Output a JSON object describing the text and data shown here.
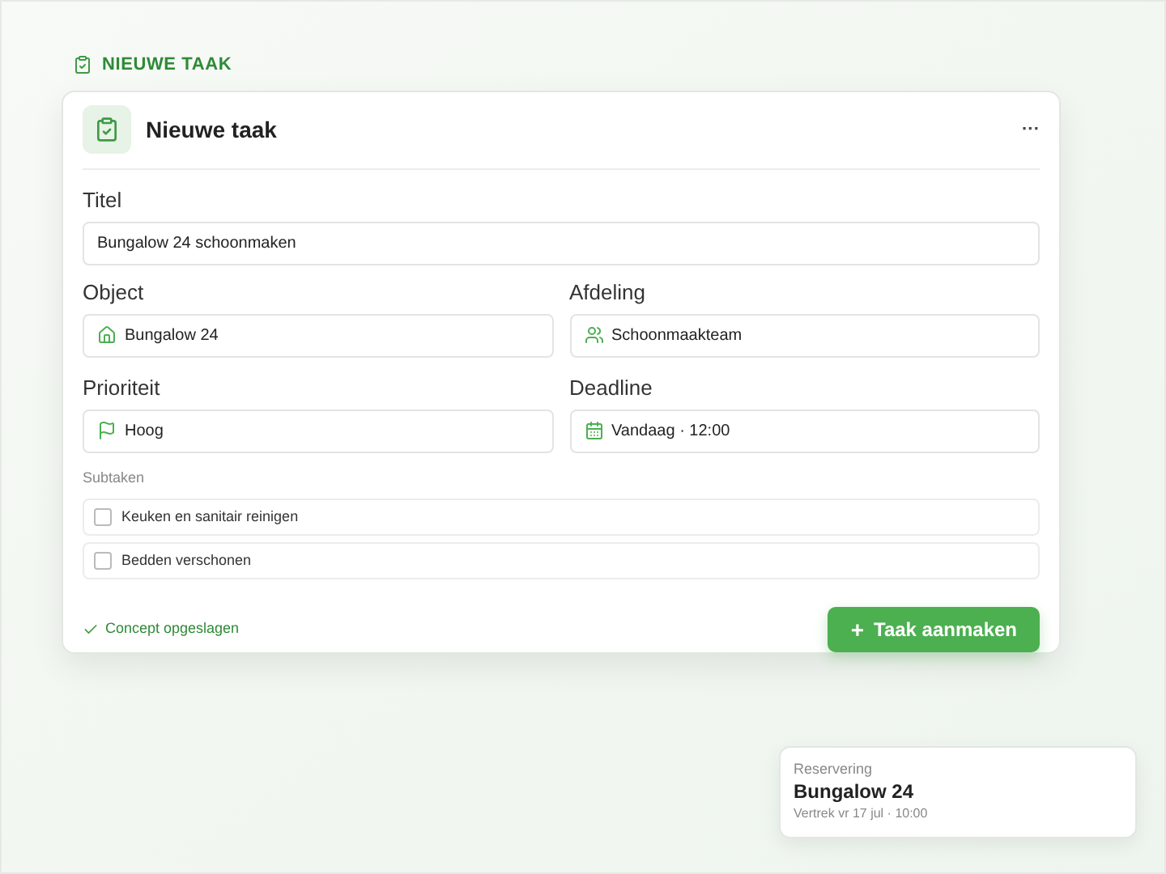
{
  "section_label": "NIEUWE TAAK",
  "dialog": {
    "title": "Nieuwe taak",
    "menu": "···",
    "title_field": {
      "label": "Titel",
      "value": "Bungalow 24 schoonmaken"
    },
    "fields": [
      {
        "label": "Object",
        "value": "Bungalow 24",
        "kind": "home"
      },
      {
        "label": "Afdeling",
        "value": "Schoonmaakteam",
        "kind": "team"
      },
      {
        "label": "Prioriteit",
        "value": "Hoog",
        "kind": "flag"
      },
      {
        "label": "Deadline",
        "value": "Vandaag · 12:00",
        "kind": "date"
      }
    ],
    "subtasks_label": "Subtaken",
    "subtasks": [
      {
        "label": "Keuken en sanitair reinigen",
        "checked": false
      },
      {
        "label": "Bedden verschonen",
        "checked": false
      }
    ],
    "status": "Concept opgeslagen",
    "submit": {
      "icon": "+",
      "label": "Taak aanmaken"
    }
  },
  "reservation": {
    "caption": "Reservering",
    "title": "Bungalow 24",
    "detail": "Vertrek vr 17 jul · 10:00"
  }
}
